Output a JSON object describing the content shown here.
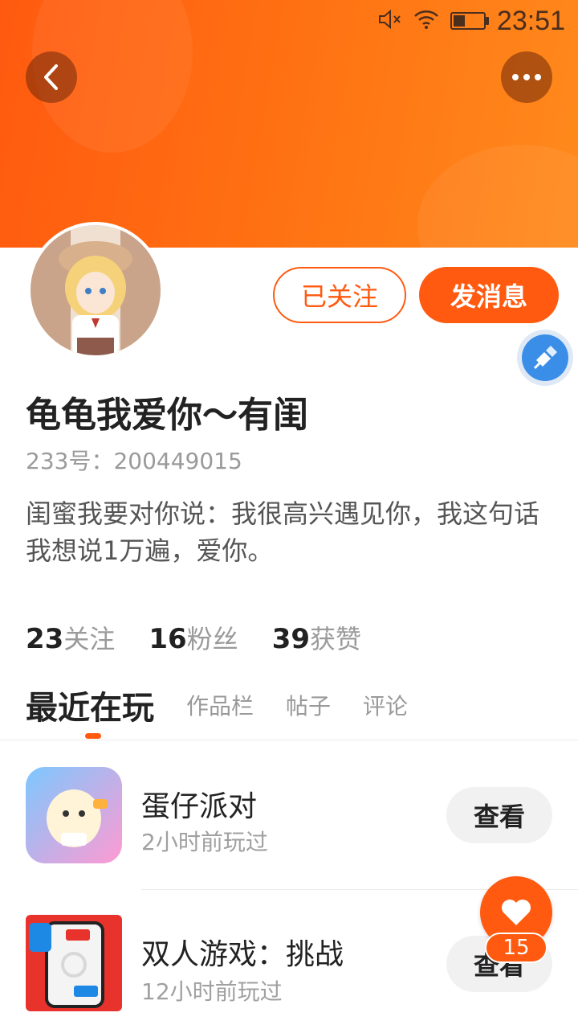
{
  "statusbar": {
    "time": "23:51"
  },
  "profile": {
    "username": "龟龟我爱你～有闺",
    "id_label": "233号：",
    "id_value": "200449015",
    "bio": "闺蜜我要对你说：我很高兴遇见你，我这句话我想说1万遍，爱你。"
  },
  "actions": {
    "follow_label": "已关注",
    "message_label": "发消息"
  },
  "stats": [
    {
      "num": "23",
      "label": "关注"
    },
    {
      "num": "16",
      "label": "粉丝"
    },
    {
      "num": "39",
      "label": "获赞"
    }
  ],
  "tabs": [
    {
      "label": "最近在玩",
      "active": true
    },
    {
      "label": "作品栏"
    },
    {
      "label": "帖子"
    },
    {
      "label": "评论"
    }
  ],
  "games": [
    {
      "name": "蛋仔派对",
      "last_played": "2小时前玩过",
      "button": "查看"
    },
    {
      "name": "双人游戏：挑战",
      "last_played": "12小时前玩过",
      "button": "查看"
    }
  ],
  "like_badge": {
    "count": "15"
  },
  "colors": {
    "accent": "#ff5a10",
    "header_start": "#ff5a10",
    "header_end": "#ff8a1c"
  },
  "icons": [
    "back-icon",
    "more-icon",
    "mute-icon",
    "wifi-icon",
    "battery-icon",
    "brush-tool-icon",
    "heart-icon"
  ]
}
